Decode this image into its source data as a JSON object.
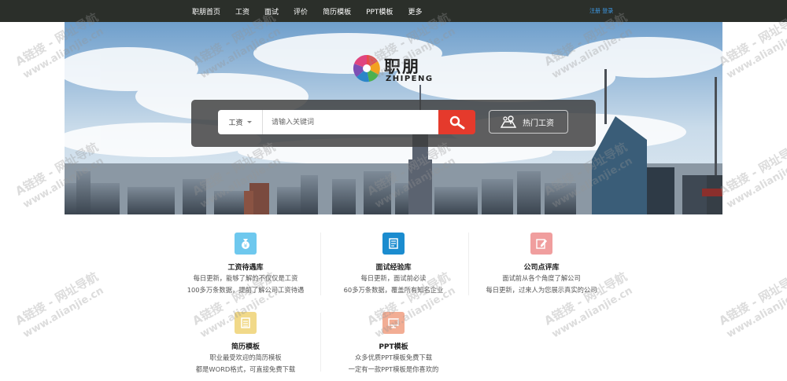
{
  "nav": {
    "items": [
      "职朋首页",
      "工资",
      "面试",
      "评价",
      "简历模板",
      "PPT模板",
      "更多"
    ],
    "register": "注册",
    "login": "登录"
  },
  "logo": {
    "name": "职朋",
    "sub": "ZHIPENG"
  },
  "search": {
    "type_label": "工资",
    "placeholder": "请输入关键词",
    "hot_label": "热门工资"
  },
  "features": [
    {
      "title": "工资待遇库",
      "line1": "每日更新，能够了解的不仅仅是工资",
      "line2": "100多万条数据，提前了解公司工资待遇",
      "color": "#6ec8ee"
    },
    {
      "title": "面试经验库",
      "line1": "每日更新，面试前必读",
      "line2": "60多万条数据，覆盖所有知名企业",
      "color": "#1b8ccf"
    },
    {
      "title": "公司点评库",
      "line1": "面试前从各个角度了解公司",
      "line2": "每日更新，过来人为您展示真实的公司",
      "color": "#f09e9e"
    },
    {
      "title": "简历模板",
      "line1": "职业最受欢迎的简历模板",
      "line2": "都是WORD格式，可直接免费下载",
      "color": "#f1d989"
    },
    {
      "title": "PPT模板",
      "line1": "众多优质PPT模板免费下载",
      "line2": "一定有一款PPT模板是你喜欢的",
      "color": "#f2ad94"
    }
  ],
  "watermark": {
    "text": "A链接 - 网址导航",
    "url": "www.alianjie.cn"
  }
}
